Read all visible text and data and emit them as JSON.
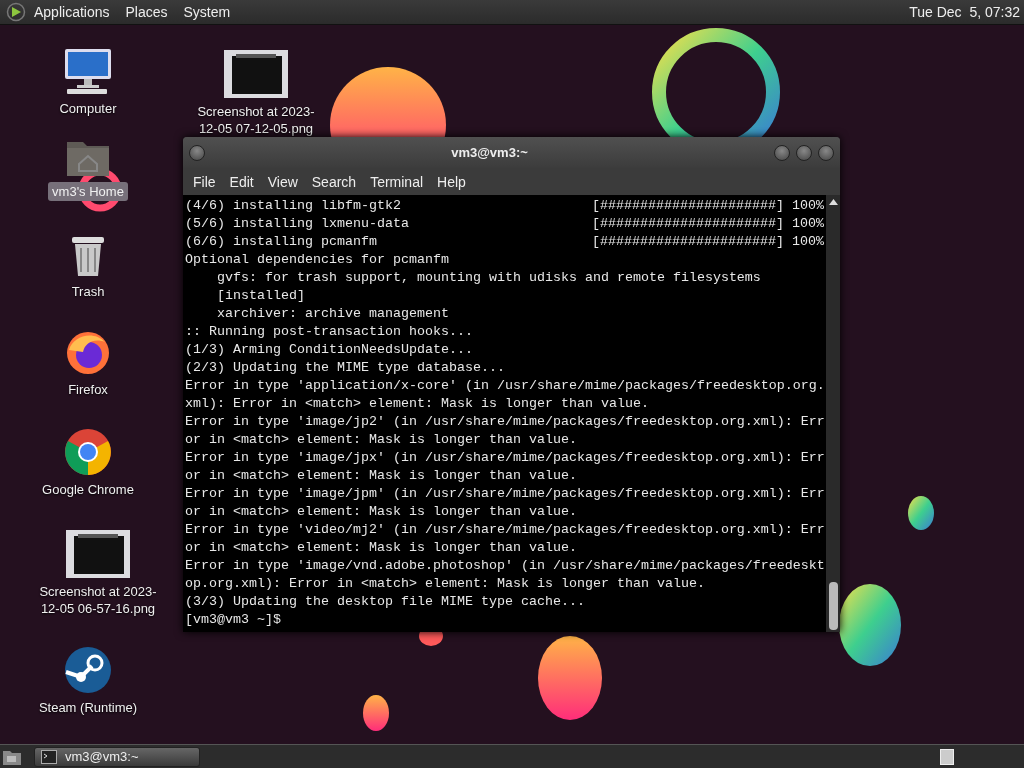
{
  "top_panel": {
    "menus": [
      "Applications",
      "Places",
      "System"
    ],
    "clock": "Tue Dec  5, 07:32"
  },
  "desktop_icons": [
    {
      "kind": "computer",
      "label": "Computer",
      "selected": false
    },
    {
      "kind": "home",
      "label": "vm3's Home",
      "selected": true
    },
    {
      "kind": "trash",
      "label": "Trash",
      "selected": false
    },
    {
      "kind": "firefox",
      "label": "Firefox",
      "selected": false
    },
    {
      "kind": "chrome",
      "label": "Google Chrome",
      "selected": false
    },
    {
      "kind": "image",
      "label": "Screenshot at 2023-12-05 06-57-16.png",
      "selected": false
    },
    {
      "kind": "steam",
      "label": "Steam (Runtime)",
      "selected": false
    },
    {
      "kind": "image",
      "label": "Screenshot at 2023-12-05 07-12-05.png",
      "selected": false
    }
  ],
  "terminal": {
    "title": "vm3@vm3:~",
    "menu": [
      "File",
      "Edit",
      "View",
      "Search",
      "Terminal",
      "Help"
    ],
    "lines": [
      {
        "text": "(4/6) installing libfm-gtk2",
        "progress": "[######################] 100%"
      },
      {
        "text": "(5/6) installing lxmenu-data",
        "progress": "[######################] 100%"
      },
      {
        "text": "(6/6) installing pcmanfm",
        "progress": "[######################] 100%"
      },
      {
        "text": "Optional dependencies for pcmanfm"
      },
      {
        "text": "    gvfs: for trash support, mounting with udisks and remote filesystems"
      },
      {
        "text": "    [installed]"
      },
      {
        "text": "    xarchiver: archive management"
      },
      {
        "text": ":: Running post-transaction hooks..."
      },
      {
        "text": "(1/3) Arming ConditionNeedsUpdate..."
      },
      {
        "text": "(2/3) Updating the MIME type database..."
      },
      {
        "text": "Error in type 'application/x-core' (in /usr/share/mime/packages/freedesktop.org."
      },
      {
        "text": "xml): Error in <match> element: Mask is longer than value."
      },
      {
        "text": "Error in type 'image/jp2' (in /usr/share/mime/packages/freedesktop.org.xml): Err"
      },
      {
        "text": "or in <match> element: Mask is longer than value."
      },
      {
        "text": "Error in type 'image/jpx' (in /usr/share/mime/packages/freedesktop.org.xml): Err"
      },
      {
        "text": "or in <match> element: Mask is longer than value."
      },
      {
        "text": "Error in type 'image/jpm' (in /usr/share/mime/packages/freedesktop.org.xml): Err"
      },
      {
        "text": "or in <match> element: Mask is longer than value."
      },
      {
        "text": "Error in type 'video/mj2' (in /usr/share/mime/packages/freedesktop.org.xml): Err"
      },
      {
        "text": "or in <match> element: Mask is longer than value."
      },
      {
        "text": "Error in type 'image/vnd.adobe.photoshop' (in /usr/share/mime/packages/freedeskt"
      },
      {
        "text": "op.org.xml): Error in <match> element: Mask is longer than value."
      },
      {
        "text": "(3/3) Updating the desktop file MIME type cache..."
      },
      {
        "text": "[vm3@vm3 ~]$"
      }
    ]
  },
  "taskbar": {
    "tasks": [
      {
        "label": "vm3@vm3:~",
        "selected": true
      }
    ]
  }
}
